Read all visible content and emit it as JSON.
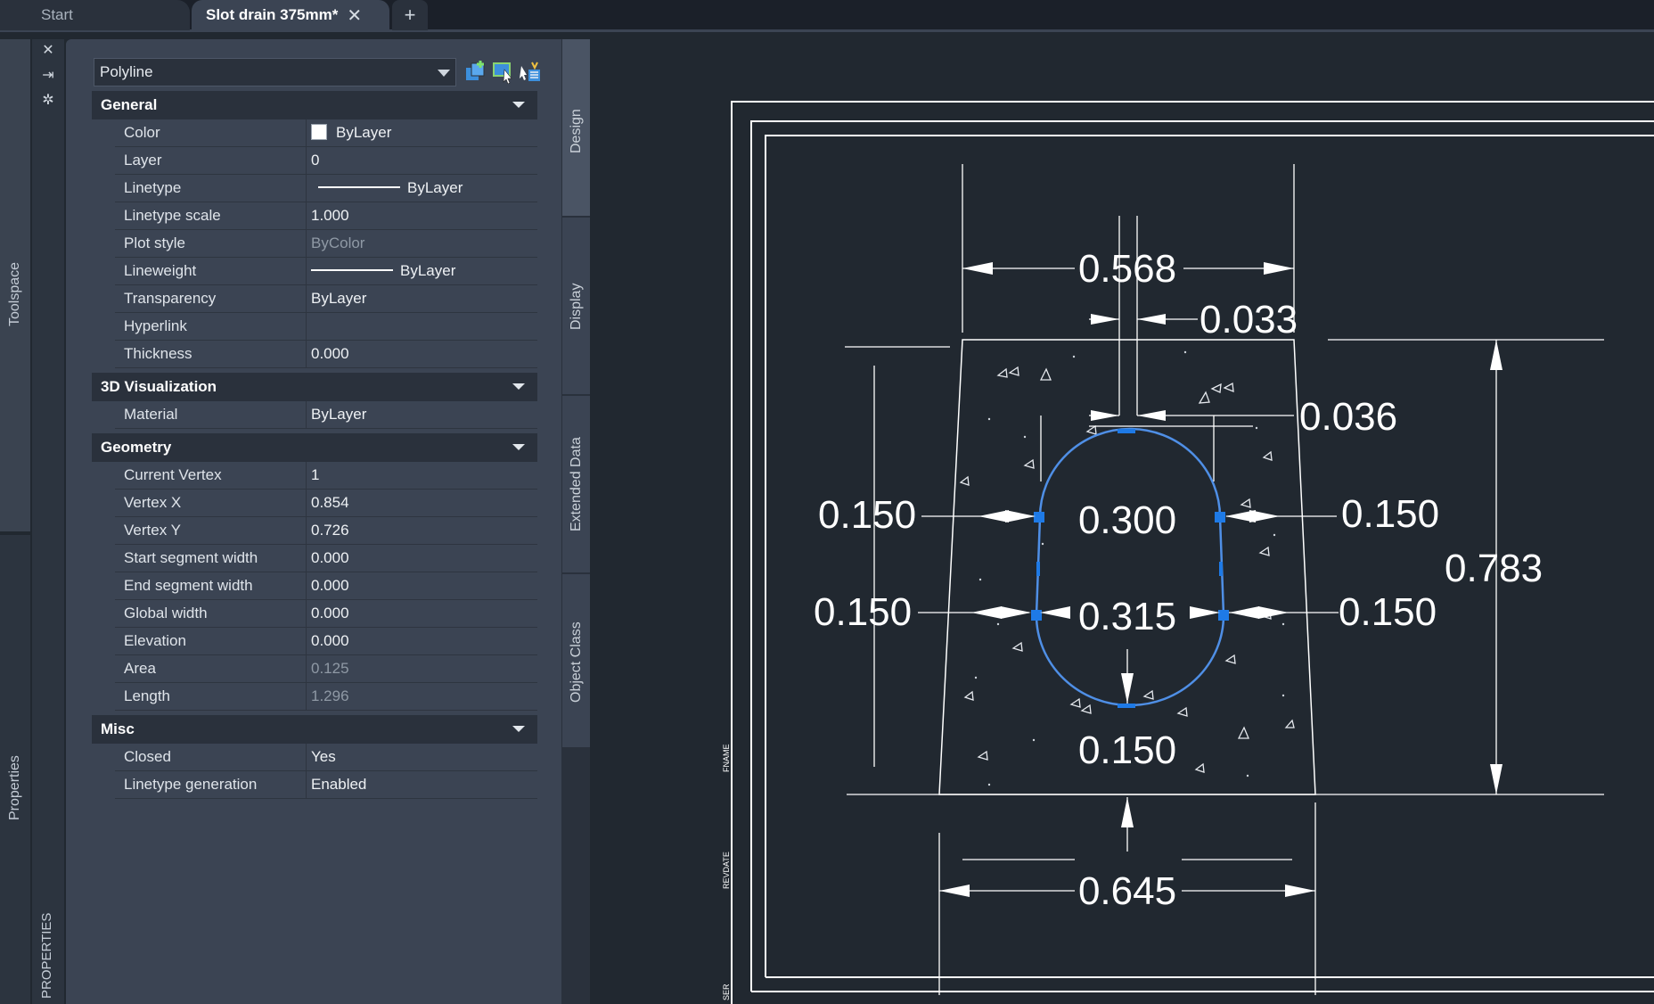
{
  "tabs": {
    "start": "Start",
    "active": "Slot drain 375mm*",
    "close": "✕",
    "add": "+"
  },
  "left_strip": {
    "toolspace": "Toolspace",
    "properties": "Properties",
    "panel_title": "PROPERTIES"
  },
  "panel": {
    "object_type": "Polyline",
    "sections": [
      {
        "name": "General",
        "rows": [
          {
            "key": "Color",
            "value": "ByLayer"
          },
          {
            "key": "Layer",
            "value": "0"
          },
          {
            "key": "Linetype",
            "value": "ByLayer"
          },
          {
            "key": "Linetype scale",
            "value": "1.000"
          },
          {
            "key": "Plot style",
            "value": "ByColor"
          },
          {
            "key": "Lineweight",
            "value": "ByLayer"
          },
          {
            "key": "Transparency",
            "value": "ByLayer"
          },
          {
            "key": "Hyperlink",
            "value": ""
          },
          {
            "key": "Thickness",
            "value": "0.000"
          }
        ]
      },
      {
        "name": "3D Visualization",
        "rows": [
          {
            "key": "Material",
            "value": "ByLayer"
          }
        ]
      },
      {
        "name": "Geometry",
        "rows": [
          {
            "key": "Current Vertex",
            "value": "1"
          },
          {
            "key": "Vertex X",
            "value": "0.854"
          },
          {
            "key": "Vertex Y",
            "value": "0.726"
          },
          {
            "key": "Start segment width",
            "value": "0.000"
          },
          {
            "key": "End segment width",
            "value": "0.000"
          },
          {
            "key": "Global width",
            "value": "0.000"
          },
          {
            "key": "Elevation",
            "value": "0.000"
          },
          {
            "key": "Area",
            "value": "0.125"
          },
          {
            "key": "Length",
            "value": "1.296"
          }
        ]
      },
      {
        "name": "Misc",
        "rows": [
          {
            "key": "Closed",
            "value": "Yes"
          },
          {
            "key": "Linetype generation",
            "value": "Enabled"
          }
        ]
      }
    ]
  },
  "side_tabs": [
    "Design",
    "Display",
    "Extended Data",
    "Object Class"
  ],
  "drawing": {
    "dimensions": {
      "top_width": "0.568",
      "slot_width": "0.033",
      "top_cover": "0.036",
      "side_left_upper": "0.150",
      "side_right_upper": "0.150",
      "inner_upper_width": "0.300",
      "side_left_lower": "0.150",
      "side_right_lower": "0.150",
      "inner_lower_width": "0.315",
      "bottom_thickness": "0.150",
      "overall_height": "0.783",
      "base_width": "0.645"
    },
    "border_labels": [
      "FNAME",
      "REVDATE",
      "SER"
    ]
  }
}
